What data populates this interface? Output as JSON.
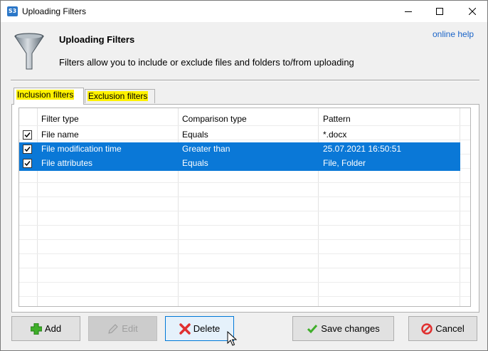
{
  "window": {
    "title": "Uploading Filters",
    "app_icon_text": "S3"
  },
  "header": {
    "title": "Uploading Filters",
    "description": "Filters allow you to include or exclude files and folders to/from uploading",
    "help_link": "online help"
  },
  "tabs": [
    {
      "label": "Inclusion filters",
      "active": true
    },
    {
      "label": "Exclusion filters",
      "active": false
    }
  ],
  "grid": {
    "columns": [
      "Filter type",
      "Comparison type",
      "Pattern"
    ],
    "rows": [
      {
        "checked": true,
        "filter_type": "File name",
        "comparison": "Equals",
        "pattern": "*.docx",
        "selected": false
      },
      {
        "checked": true,
        "filter_type": "File modification time",
        "comparison": "Greater than",
        "pattern": "25.07.2021 16:50:51",
        "selected": true
      },
      {
        "checked": true,
        "filter_type": "File attributes",
        "comparison": "Equals",
        "pattern": "File, Folder",
        "selected": true
      }
    ]
  },
  "buttons": {
    "add": "Add",
    "edit": "Edit",
    "delete": "Delete",
    "save": "Save changes",
    "cancel": "Cancel"
  },
  "colors": {
    "selection": "#0a78d7",
    "tab_highlight": "#fff200",
    "link": "#1a64c8"
  }
}
